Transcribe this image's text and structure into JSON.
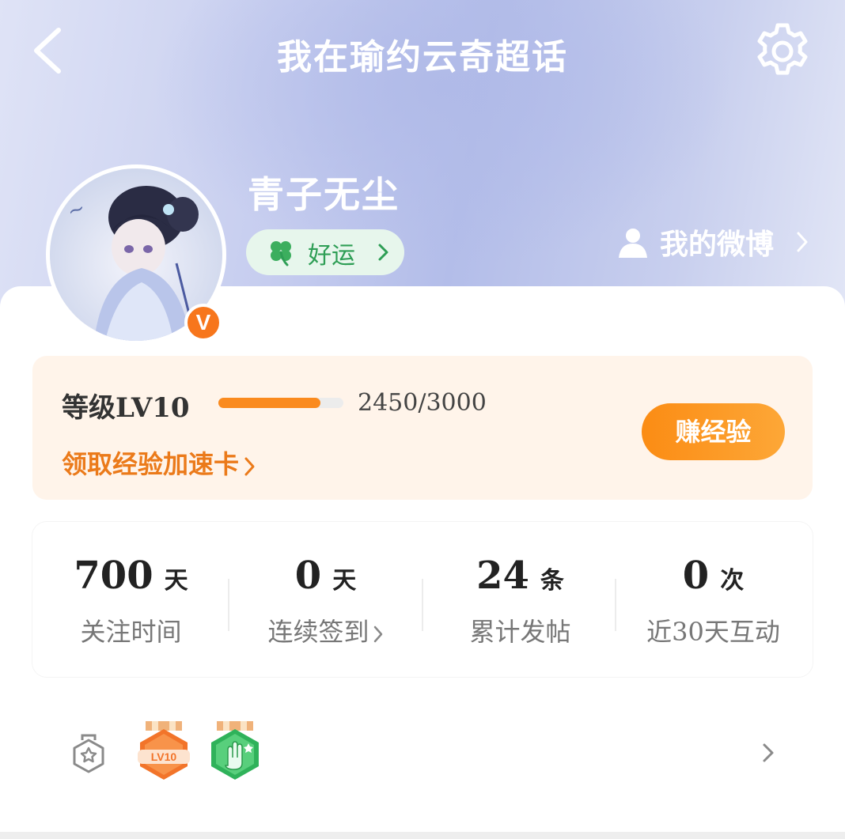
{
  "header": {
    "title": "我在瑜约云奇超话",
    "back_icon": "chevron-left-icon",
    "settings_icon": "gear-icon"
  },
  "profile": {
    "username": "青子无尘",
    "verified_badge": "V",
    "luck_label": "好运",
    "my_weibo_label": "我的微博"
  },
  "level": {
    "label": "等级LV10",
    "progress_text": "2450/3000",
    "progress_value": 0.8167,
    "accelerate_link": "领取经验加速卡",
    "earn_button": "赚经验"
  },
  "stats": [
    {
      "value": "700",
      "unit": "天",
      "label": "关注时间"
    },
    {
      "value": "0",
      "unit": "天",
      "label": "连续签到"
    },
    {
      "value": "24",
      "unit": "条",
      "label": "累计发帖"
    },
    {
      "value": "0",
      "unit": "次",
      "label": "近30天互动"
    }
  ],
  "badges": {
    "items": [
      "LV10"
    ]
  },
  "colors": {
    "accent_orange": "#fa8a1e",
    "luck_green": "#2e9e55",
    "verified_orange": "#f7761c"
  }
}
